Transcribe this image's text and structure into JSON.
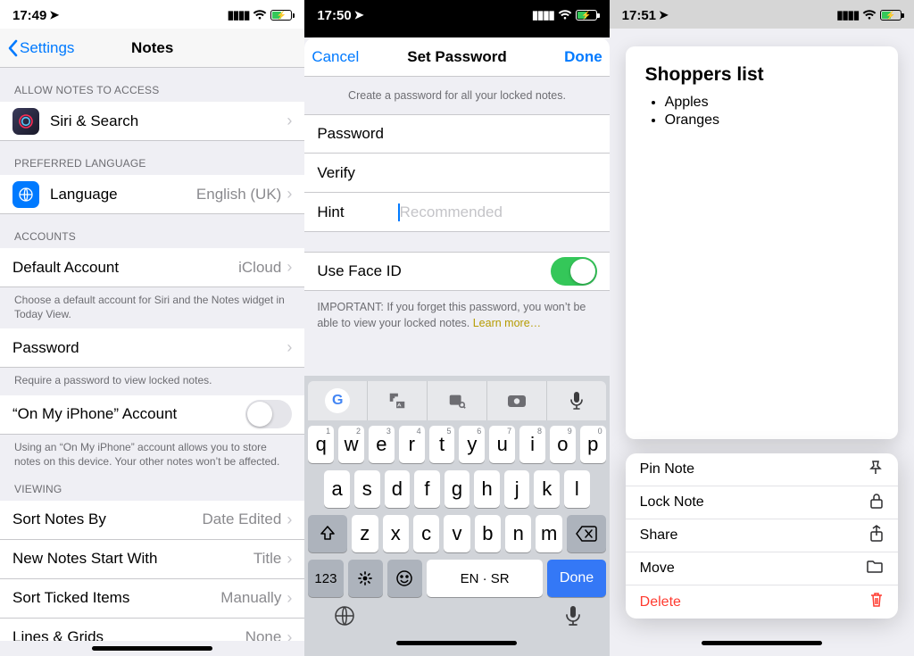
{
  "panel1": {
    "statusTime": "17:49",
    "backLabel": "Settings",
    "title": "Notes",
    "sectionAccess": "ALLOW NOTES TO ACCESS",
    "siri": "Siri & Search",
    "sectionLang": "PREFERRED LANGUAGE",
    "language": "Language",
    "languageVal": "English (UK)",
    "sectionAccounts": "ACCOUNTS",
    "defaultAccount": "Default Account",
    "defaultAccountVal": "iCloud",
    "defaultAccountFooter": "Choose a default account for Siri and the Notes widget in Today View.",
    "password": "Password",
    "passwordFooter": "Require a password to view locked notes.",
    "onMyIphone": "“On My iPhone” Account",
    "onMyIphoneFooter": "Using an “On My iPhone” account allows you to store notes on this device. Your other notes won’t be affected.",
    "sectionViewing": "VIEWING",
    "sortBy": "Sort Notes By",
    "sortByVal": "Date Edited",
    "newNotesStart": "New Notes Start With",
    "newNotesStartVal": "Title",
    "sortTicked": "Sort Ticked Items",
    "sortTickedVal": "Manually",
    "linesGrids": "Lines & Grids",
    "linesGridsVal": "None"
  },
  "panel2": {
    "statusTime": "17:50",
    "cancel": "Cancel",
    "title": "Set Password",
    "done": "Done",
    "instructions": "Create a password for all your locked notes.",
    "fields": {
      "password": "Password",
      "verify": "Verify",
      "hint": "Hint",
      "hintPlaceholder": "Recommended"
    },
    "faceId": "Use Face ID",
    "importantPrefix": "IMPORTANT: If you forget this password, you won’t be able to view your locked notes. ",
    "learnMore": "Learn more…",
    "keyboard": {
      "row1": [
        "q",
        "w",
        "e",
        "r",
        "t",
        "y",
        "u",
        "i",
        "o",
        "p"
      ],
      "row1hints": [
        "1",
        "2",
        "3",
        "4",
        "5",
        "6",
        "7",
        "8",
        "9",
        "0"
      ],
      "row2": [
        "a",
        "s",
        "d",
        "f",
        "g",
        "h",
        "j",
        "k",
        "l"
      ],
      "row3": [
        "z",
        "x",
        "c",
        "v",
        "b",
        "n",
        "m"
      ],
      "numKey": "123",
      "space": "EN · SR",
      "doneKey": "Done"
    }
  },
  "panel3": {
    "statusTime": "17:51",
    "noteTitle": "Shoppers list",
    "items": [
      "Apples",
      "Oranges"
    ],
    "actions": {
      "pin": "Pin Note",
      "lock": "Lock Note",
      "share": "Share",
      "move": "Move",
      "delete": "Delete"
    }
  }
}
